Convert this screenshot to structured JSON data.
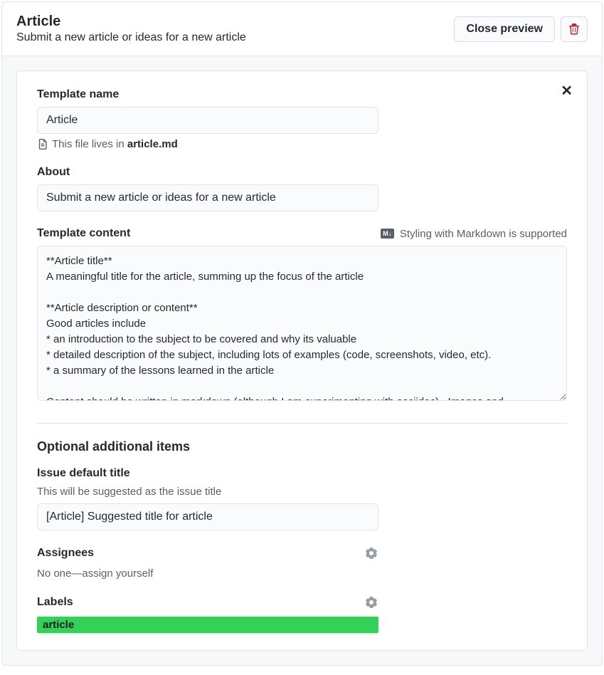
{
  "header": {
    "title": "Article",
    "subtitle": "Submit a new article or ideas for a new article",
    "close_preview_label": "Close preview"
  },
  "template": {
    "name_label": "Template name",
    "name_value": "Article",
    "file_hint_prefix": "This file lives in ",
    "file_name": "article.md",
    "about_label": "About",
    "about_value": "Submit a new article or ideas for a new article",
    "content_label": "Template content",
    "markdown_hint": "Styling with Markdown is supported",
    "markdown_badge": "M↓",
    "content_value": "**Article title**\nA meaningful title for the article, summing up the focus of the article\n\n**Article description or content**\nGood articles include\n* an introduction to the subject to be covered and why its valuable\n* detailed description of the subject, including lots of examples (code, screenshots, video, etc).\n* a summary of the lessons learned in the article\n\nContent should be written in markdown (although I am experimenting with asciidoc).  Images and"
  },
  "optional": {
    "heading": "Optional additional items",
    "default_title_label": "Issue default title",
    "default_title_hint": "This will be suggested as the issue title",
    "default_title_value": "[Article] Suggested title for article",
    "assignees_label": "Assignees",
    "assignees_empty": "No one—assign yourself",
    "labels_label": "Labels",
    "label_chip": "article"
  }
}
